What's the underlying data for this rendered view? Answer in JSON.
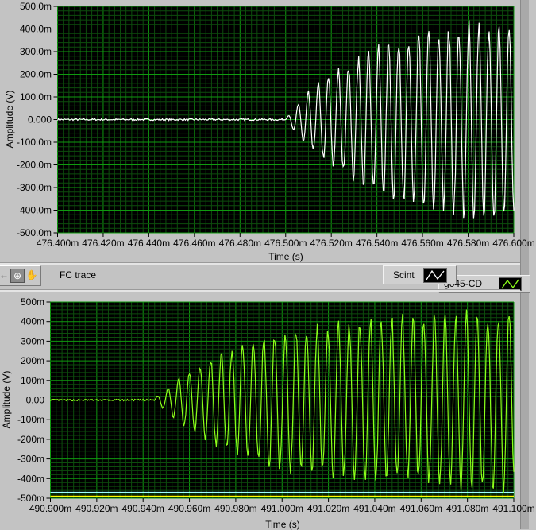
{
  "toolbar": {
    "tools": [
      {
        "name": "cursor-tool",
        "icon": "cursor-arrow-icon",
        "glyph": "←"
      },
      {
        "name": "zoom-tool",
        "icon": "zoom-magnifier-icon",
        "glyph": "⊕",
        "pressed": true
      },
      {
        "name": "pan-tool",
        "icon": "hand-pan-icon",
        "glyph": "✋"
      }
    ],
    "graph_name": "FC trace"
  },
  "legends": [
    {
      "label": "Scint",
      "color": "#ffffff"
    },
    {
      "label": "g645-CD",
      "color": "#8cff1a"
    }
  ],
  "chart_data": [
    {
      "type": "line",
      "xlabel": "Time (s)",
      "ylabel": "Amplitude (V)",
      "xlim": [
        476.4,
        476.6
      ],
      "ylim": [
        -0.5,
        0.5
      ],
      "x_unit_note": "ms",
      "x_ticks": [
        "476.400m",
        "476.420m",
        "476.440m",
        "476.460m",
        "476.480m",
        "476.500m",
        "476.520m",
        "476.540m",
        "476.560m",
        "476.580m",
        "476.600m"
      ],
      "y_ticks": [
        "500.0m",
        "400.0m",
        "300.0m",
        "200.0m",
        "100.0m",
        "0.000",
        "-100.0m",
        "-200.0m",
        "-300.0m",
        "-400.0m",
        "-500.0m"
      ],
      "grid": true,
      "background": "#000000",
      "series": [
        {
          "name": "Scint",
          "color": "#ffffff",
          "onset_time_ms": 476.5,
          "oscillation_period_ms": 4.4,
          "peak_amplitude_envelope": [
            [
              476.4,
              0.003
            ],
            [
              476.5,
              0.005
            ],
            [
              476.51,
              0.12
            ],
            [
              476.52,
              0.2
            ],
            [
              476.54,
              0.32
            ],
            [
              476.56,
              0.39
            ],
            [
              476.58,
              0.42
            ],
            [
              476.6,
              0.43
            ]
          ]
        }
      ]
    },
    {
      "type": "line",
      "xlabel": "Time (s)",
      "ylabel": "Amplitude (V)",
      "xlim": [
        490.9,
        491.1
      ],
      "ylim": [
        -0.5,
        0.5
      ],
      "x_ticks": [
        "490.900m",
        "490.920m",
        "490.940m",
        "490.960m",
        "490.980m",
        "491.000m",
        "491.020m",
        "491.040m",
        "491.060m",
        "491.080m",
        "491.100m"
      ],
      "y_ticks": [
        "500m",
        "400m",
        "300m",
        "200m",
        "100m",
        "0.00",
        "-100m",
        "-200m",
        "-300m",
        "-400m",
        "-500m"
      ],
      "grid": true,
      "background": "#000000",
      "series": [
        {
          "name": "g645-CD",
          "color": "#8cff1a",
          "onset_time_ms": 490.945,
          "oscillation_period_ms": 4.6,
          "peak_amplitude_envelope": [
            [
              490.9,
              0.003
            ],
            [
              490.945,
              0.01
            ],
            [
              490.96,
              0.15
            ],
            [
              490.975,
              0.25
            ],
            [
              491.0,
              0.35
            ],
            [
              491.04,
              0.41
            ],
            [
              491.1,
              0.44
            ]
          ]
        }
      ],
      "reference_lines": [
        {
          "value": -0.47,
          "color": "#a0ffff"
        },
        {
          "value": -0.49,
          "color": "#ffff00"
        }
      ]
    }
  ]
}
